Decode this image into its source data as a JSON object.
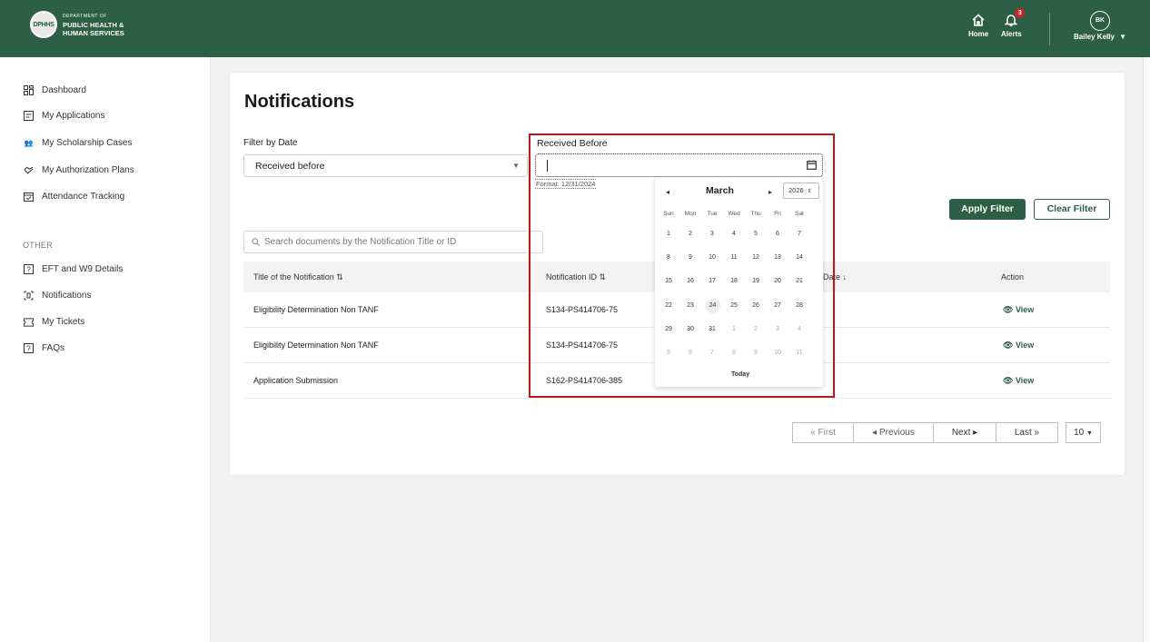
{
  "header": {
    "logo": {
      "seal": "MONTANA DPHHS",
      "line1": "DEPARTMENT OF",
      "line2": "PUBLIC HEALTH &",
      "line3": "HUMAN SERVICES"
    },
    "home_label": "Home",
    "alerts_label": "Alerts",
    "alerts_count": "3",
    "user_initials": "BK",
    "user_name": "Bailey Kelly"
  },
  "sidebar": {
    "items": [
      {
        "label": "Dashboard",
        "icon": "dashboard-icon"
      },
      {
        "label": "My Applications",
        "icon": "applications-icon"
      },
      {
        "label": "My Scholarship Cases",
        "icon": "people-icon"
      },
      {
        "label": "My Authorization Plans",
        "icon": "handshake-icon"
      },
      {
        "label": "Attendance Tracking",
        "icon": "calendar-check-icon"
      }
    ],
    "section_label": "OTHER",
    "other_items": [
      {
        "label": "EFT and W9 Details",
        "icon": "help-box-icon"
      },
      {
        "label": "Notifications",
        "icon": "notifications-icon"
      },
      {
        "label": "My Tickets",
        "icon": "tickets-icon"
      },
      {
        "label": "FAQs",
        "icon": "help-box-icon"
      }
    ]
  },
  "main": {
    "title": "Notifications",
    "filter_label": "Filter by Date",
    "filter_value": "Received before",
    "date_label": "Received Before",
    "date_value": "",
    "date_format_hint": "Format: 12/31/2024",
    "apply_label": "Apply Filter",
    "clear_label": "Clear Filter",
    "search_placeholder": "Search documents by the Notification Title or ID",
    "columns": [
      "Title of the Notification",
      "Notification ID",
      "Date",
      "Action"
    ],
    "rows": [
      {
        "title": "Eligibility Determination Non TANF",
        "id": "S134-PS414706-75",
        "action": "View"
      },
      {
        "title": "Eligibility Determination Non TANF",
        "id": "S134-PS414706-75",
        "action": "View"
      },
      {
        "title": "Application Submission",
        "id": "S162-PS414706-385",
        "action": "View"
      }
    ],
    "pagination": {
      "first": "« First",
      "previous": "◂ Previous",
      "next": "Next ▸",
      "last": "Last »",
      "page_size": "10"
    }
  },
  "calendar": {
    "month": "March",
    "year": "2026",
    "weekdays": [
      "Sun",
      "Mon",
      "Tue",
      "Wed",
      "Thu",
      "Fri",
      "Sat"
    ],
    "weeks": [
      [
        "1",
        "2",
        "3",
        "4",
        "5",
        "6",
        "7"
      ],
      [
        "8",
        "9",
        "10",
        "11",
        "12",
        "13",
        "14"
      ],
      [
        "15",
        "16",
        "17",
        "18",
        "19",
        "20",
        "21"
      ],
      [
        "22",
        "23",
        "24",
        "25",
        "26",
        "27",
        "28"
      ],
      [
        "29",
        "30",
        "31",
        "1",
        "2",
        "3",
        "4"
      ],
      [
        "5",
        "6",
        "7",
        "8",
        "9",
        "10",
        "11"
      ]
    ],
    "today_label": "Today"
  },
  "colors": {
    "brand": "#2d5f47",
    "highlight": "#c0151b",
    "badge": "#c62828"
  }
}
